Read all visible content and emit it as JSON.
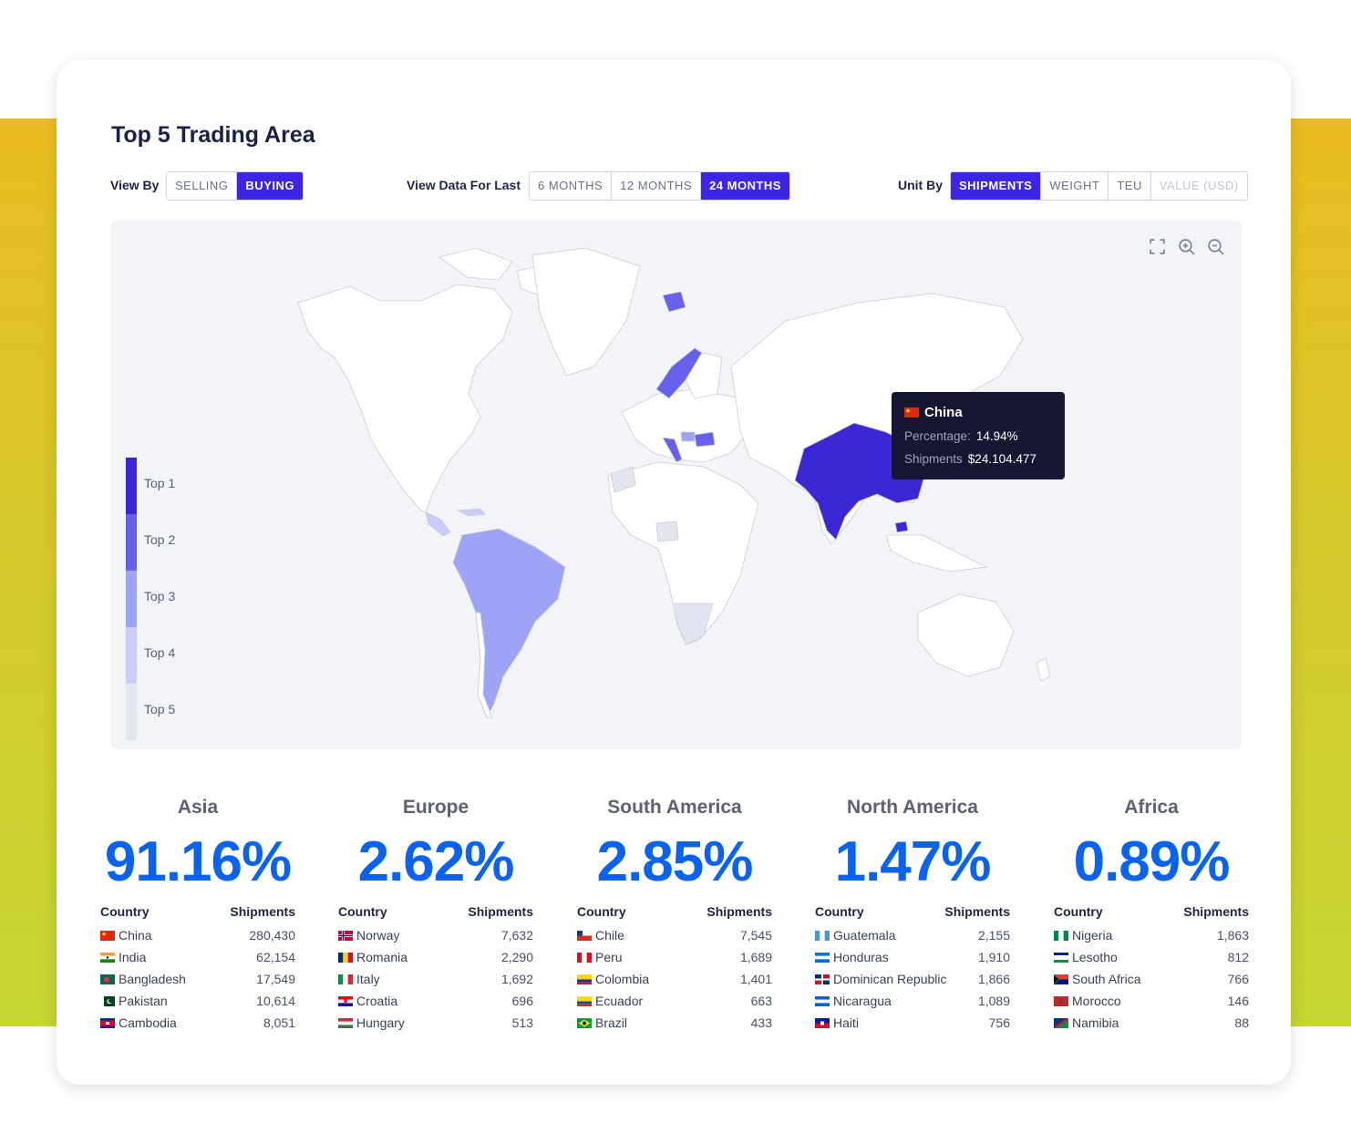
{
  "title": "Top 5 Trading Area",
  "view_by": {
    "label": "View By",
    "options": [
      "SELLING",
      "BUYING"
    ],
    "selected": "BUYING"
  },
  "view_data_for_last": {
    "label": "View Data For Last",
    "options": [
      "6 MONTHS",
      "12 MONTHS",
      "24 MONTHS"
    ],
    "selected": "24 MONTHS"
  },
  "unit_by": {
    "label": "Unit By",
    "options": [
      "SHIPMENTS",
      "WEIGHT",
      "TEU",
      "VALUE (USD)"
    ],
    "selected": "SHIPMENTS",
    "disabled": "VALUE (USD)"
  },
  "map": {
    "tools": [
      "fullscreen-icon",
      "zoom-in-icon",
      "zoom-out-icon"
    ],
    "legend": [
      "Top 1",
      "Top 2",
      "Top 3",
      "Top 4",
      "Top 5"
    ],
    "legend_colors": [
      "#3b27d4",
      "#6660ec",
      "#9ea4f5",
      "#c9cdf9",
      "#e3e6f1"
    ],
    "base_land_color": "#ffffff",
    "tooltip": {
      "country": "China",
      "percentage_label": "Percentage:",
      "percentage_value": "14.94%",
      "shipments_label": "Shipments",
      "shipments_value": "$24.104.477"
    }
  },
  "column_headers": {
    "country": "Country",
    "shipments": "Shipments"
  },
  "regions": [
    {
      "name": "Asia",
      "percent": "91.16%",
      "rows": [
        {
          "country": "China",
          "shipments": "280,430",
          "flag": "china"
        },
        {
          "country": "India",
          "shipments": "62,154",
          "flag": "india"
        },
        {
          "country": "Bangladesh",
          "shipments": "17,549",
          "flag": "bangladesh"
        },
        {
          "country": "Pakistan",
          "shipments": "10,614",
          "flag": "pakistan"
        },
        {
          "country": "Cambodia",
          "shipments": "8,051",
          "flag": "cambodia"
        }
      ]
    },
    {
      "name": "Europe",
      "percent": "2.62%",
      "rows": [
        {
          "country": "Norway",
          "shipments": "7,632",
          "flag": "norway"
        },
        {
          "country": "Romania",
          "shipments": "2,290",
          "flag": "romania"
        },
        {
          "country": "Italy",
          "shipments": "1,692",
          "flag": "italy"
        },
        {
          "country": "Croatia",
          "shipments": "696",
          "flag": "croatia"
        },
        {
          "country": "Hungary",
          "shipments": "513",
          "flag": "hungary"
        }
      ]
    },
    {
      "name": "South America",
      "percent": "2.85%",
      "rows": [
        {
          "country": "Chile",
          "shipments": "7,545",
          "flag": "chile"
        },
        {
          "country": "Peru",
          "shipments": "1,689",
          "flag": "peru"
        },
        {
          "country": "Colombia",
          "shipments": "1,401",
          "flag": "colombia"
        },
        {
          "country": "Ecuador",
          "shipments": "663",
          "flag": "ecuador"
        },
        {
          "country": "Brazil",
          "shipments": "433",
          "flag": "brazil"
        }
      ]
    },
    {
      "name": "North America",
      "percent": "1.47%",
      "rows": [
        {
          "country": "Guatemala",
          "shipments": "2,155",
          "flag": "guatemala"
        },
        {
          "country": "Honduras",
          "shipments": "1,910",
          "flag": "honduras"
        },
        {
          "country": "Dominican Republic",
          "shipments": "1,866",
          "flag": "dominican-republic"
        },
        {
          "country": "Nicaragua",
          "shipments": "1,089",
          "flag": "nicaragua"
        },
        {
          "country": "Haiti",
          "shipments": "756",
          "flag": "haiti"
        }
      ]
    },
    {
      "name": "Africa",
      "percent": "0.89%",
      "rows": [
        {
          "country": "Nigeria",
          "shipments": "1,863",
          "flag": "nigeria"
        },
        {
          "country": "Lesotho",
          "shipments": "812",
          "flag": "lesotho"
        },
        {
          "country": "South Africa",
          "shipments": "766",
          "flag": "south-africa"
        },
        {
          "country": "Morocco",
          "shipments": "146",
          "flag": "morocco"
        },
        {
          "country": "Namibia",
          "shipments": "88",
          "flag": "namibia"
        }
      ]
    }
  ]
}
